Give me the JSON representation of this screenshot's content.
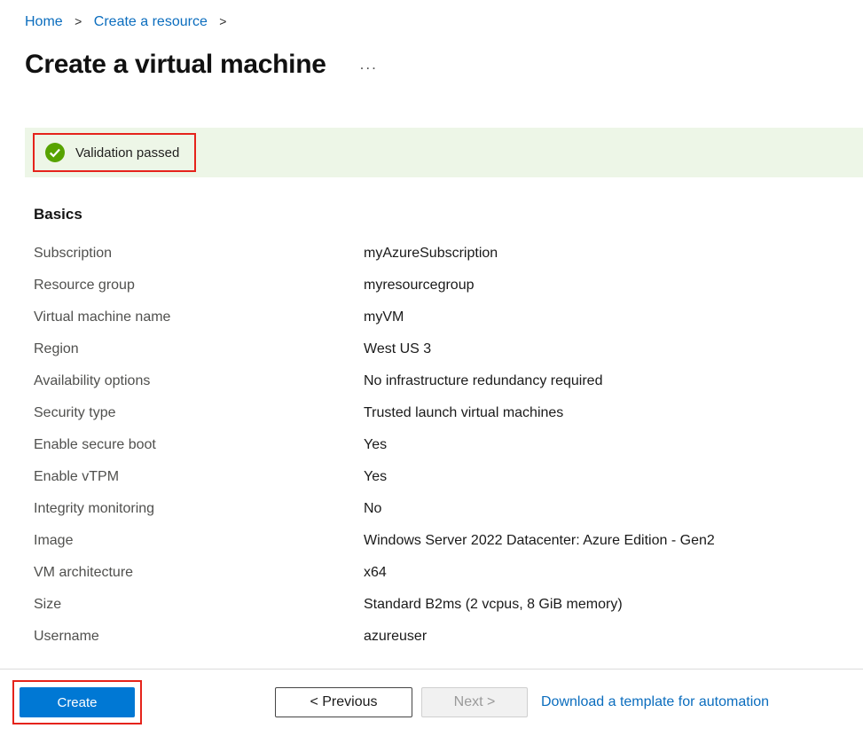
{
  "breadcrumb": {
    "separator": ">",
    "items": [
      {
        "label": "Home"
      },
      {
        "label": "Create a resource"
      }
    ]
  },
  "header": {
    "title": "Create a virtual machine",
    "more_label": "..."
  },
  "validation": {
    "message": "Validation passed",
    "icon": "success-check-icon"
  },
  "basics": {
    "section_title": "Basics",
    "rows": [
      {
        "label": "Subscription",
        "value": "myAzureSubscription"
      },
      {
        "label": "Resource group",
        "value": "myresourcegroup"
      },
      {
        "label": "Virtual machine name",
        "value": "myVM"
      },
      {
        "label": "Region",
        "value": "West US 3"
      },
      {
        "label": "Availability options",
        "value": "No infrastructure redundancy required"
      },
      {
        "label": "Security type",
        "value": "Trusted launch virtual machines"
      },
      {
        "label": "Enable secure boot",
        "value": "Yes"
      },
      {
        "label": "Enable vTPM",
        "value": "Yes"
      },
      {
        "label": "Integrity monitoring",
        "value": "No"
      },
      {
        "label": "Image",
        "value": "Windows Server 2022 Datacenter: Azure Edition - Gen2"
      },
      {
        "label": "VM architecture",
        "value": "x64"
      },
      {
        "label": "Size",
        "value": "Standard B2ms (2 vcpus, 8 GiB memory)"
      },
      {
        "label": "Username",
        "value": "azureuser"
      }
    ]
  },
  "footer": {
    "create_label": "Create",
    "previous_label": "< Previous",
    "next_label": "Next >",
    "download_link": "Download a template for automation"
  },
  "colors": {
    "link_blue": "#0b6dbe",
    "primary_button_blue": "#0078d4",
    "success_green": "#57a300",
    "banner_background": "#edf6e7",
    "annotation_red": "#e5231b"
  }
}
